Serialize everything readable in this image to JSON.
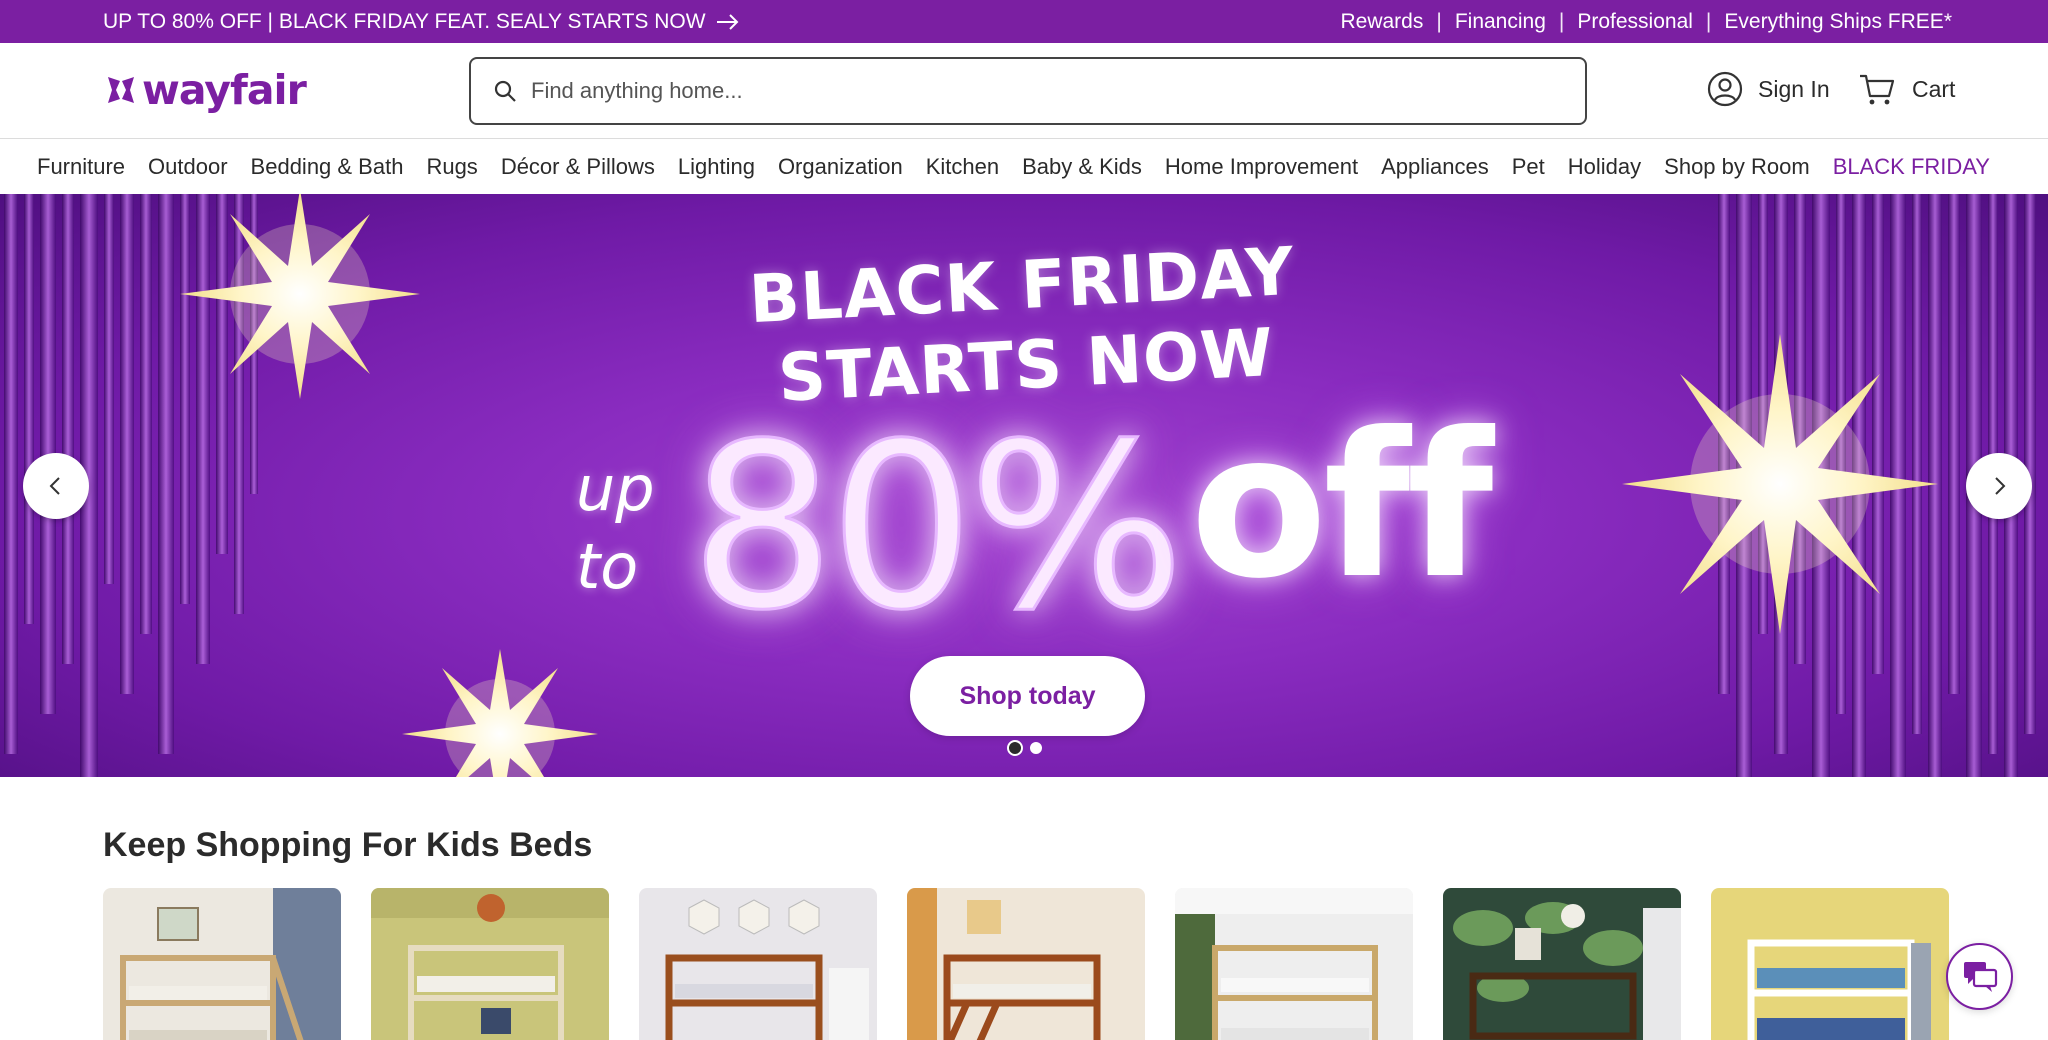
{
  "promo_bar": {
    "left_text": "UP TO 80% OFF | BLACK FRIDAY FEAT. SEALY STARTS NOW",
    "links": [
      "Rewards",
      "Financing",
      "Professional",
      "Everything Ships FREE*"
    ],
    "separator": "|",
    "background": "#7b1fa2"
  },
  "header": {
    "logo_text": "wayfair",
    "search_placeholder": "Find anything home...",
    "sign_in_label": "Sign In",
    "cart_label": "Cart"
  },
  "categories": [
    "Furniture",
    "Outdoor",
    "Bedding & Bath",
    "Rugs",
    "Décor & Pillows",
    "Lighting",
    "Organization",
    "Kitchen",
    "Baby & Kids",
    "Home Improvement",
    "Appliances",
    "Pet",
    "Holiday",
    "Shop by Room",
    "BLACK FRIDAY"
  ],
  "hero": {
    "headline_line1": "BLACK FRIDAY",
    "headline_line2": "STARTS NOW",
    "up": "up",
    "to": "to",
    "percent": "80%",
    "off": "off",
    "cta_label": "Shop today",
    "slide_count": 2,
    "active_slide": 1
  },
  "section": {
    "title": "Keep Shopping For Kids Beds",
    "tile_count": 7
  },
  "colors": {
    "accent": "#7b1fa2",
    "text": "#2b2b2b"
  },
  "icons": [
    "arrow-right-icon",
    "search-icon",
    "user-icon",
    "cart-icon",
    "chevron-left-icon",
    "chevron-right-icon",
    "chat-icon"
  ]
}
